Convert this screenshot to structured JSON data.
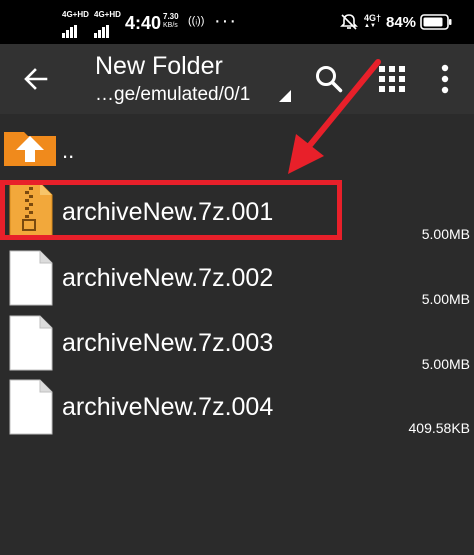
{
  "status_bar": {
    "sim1_label": "4G+HD",
    "sim2_label": "4G+HD",
    "time": "4:40",
    "speed_value": "7.30",
    "speed_unit": "KB/s",
    "overflow_dots": "···",
    "network_label": "4G†",
    "battery_percent": "84%"
  },
  "toolbar": {
    "title": "New Folder",
    "path": "…ge/emulated/0/1"
  },
  "parent_entry": {
    "label": ".."
  },
  "files": [
    {
      "name": "archiveNew.7z.001",
      "size": "5.00MB",
      "icon": "zip-archive-icon",
      "highlighted": true
    },
    {
      "name": "archiveNew.7z.002",
      "size": "5.00MB",
      "icon": "blank-file-icon",
      "highlighted": false
    },
    {
      "name": "archiveNew.7z.003",
      "size": "5.00MB",
      "icon": "blank-file-icon",
      "highlighted": false
    },
    {
      "name": "archiveNew.7z.004",
      "size": "409.58KB",
      "icon": "blank-file-icon",
      "highlighted": false
    }
  ],
  "colors": {
    "highlight_box": "#e8202a",
    "arrow": "#e8202a",
    "folder": "#f08a1c",
    "toolbar_bg": "#323232",
    "list_bg": "#2b2b2b"
  }
}
